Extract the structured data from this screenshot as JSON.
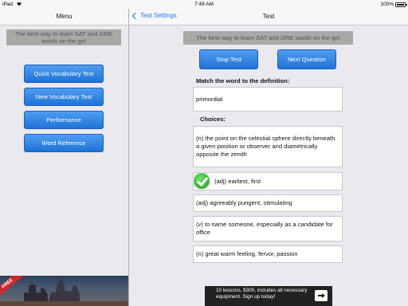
{
  "status_bar": {
    "carrier": "iPad",
    "time": "7:49 AM",
    "battery_pct": "100%",
    "battery_level": 1.0
  },
  "menu": {
    "title": "Menu",
    "tagline": "The best way to learn SAT and GRE words on the go!",
    "buttons": [
      {
        "label": "Quick Vocabulary Test"
      },
      {
        "label": "New Vocabulary Test"
      },
      {
        "label": "Performance"
      },
      {
        "label": "Word Reference"
      }
    ],
    "ad_badge": "FREE"
  },
  "test": {
    "back_label": "Test Settings",
    "title": "Test",
    "tagline": "The best way to learn SAT and GRE words on the go!",
    "stop_label": "Stop Test",
    "next_label": "Next Question",
    "prompt_label": "Match the word to the definition:",
    "word": "primordial",
    "choices_label": "Choices:",
    "choices": [
      {
        "text": "(n) the point on the celestial sphere directly beneath a given position or observer and diametrically opposite the zenith",
        "correct": false
      },
      {
        "text": "(adj) earliest, first",
        "correct": true
      },
      {
        "text": "(adj) agreeably pungent, stimulating",
        "correct": false
      },
      {
        "text": "(v) to name someone, especially as a candidate for office",
        "correct": false
      },
      {
        "text": "(n) great warm feeling, fervor, passion",
        "correct": false
      }
    ],
    "ad_text": "10 lessons, $300, includes all necessary equipment. Sign up today!"
  },
  "colors": {
    "accent": "#1a7cf5",
    "button_blue": "#2a80e0",
    "correct_green": "#2fb52a"
  }
}
